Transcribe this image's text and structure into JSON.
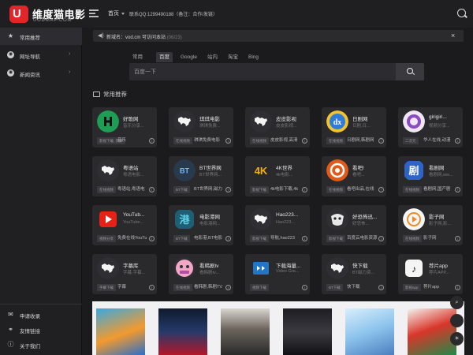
{
  "header": {
    "logo_mark": "U",
    "logo_title": "维度猫电影",
    "logo_sub": "UODMAP.COM",
    "nav_home": "首页",
    "contact": "联系QQ:1299490188（备注：合作/发链）"
  },
  "sidebar": {
    "items": [
      {
        "label": "常用推荐"
      },
      {
        "label": "网址导航",
        "arrow": "›"
      },
      {
        "label": "新闻资讯",
        "arrow": "›"
      }
    ],
    "bottom": [
      {
        "label": "申请收录"
      },
      {
        "label": "友情链接"
      },
      {
        "label": "关于我们"
      }
    ]
  },
  "notice": {
    "text": "新域名：vod.cm 可访问本站",
    "date": "(06/23)",
    "close": "×"
  },
  "search": {
    "tabs": [
      "常用",
      "百度",
      "Google",
      "站内",
      "淘宝",
      "Bing"
    ],
    "active_tab": 1,
    "placeholder": "百度一下"
  },
  "section": {
    "title": "常用推荐"
  },
  "cards": [
    {
      "name": "好歌网",
      "desc": "音乐分享...",
      "tag": "影视下载, 资源",
      "sub": "音乐",
      "icon": "h",
      "color": "#1f9d55"
    },
    {
      "name": "琪琪电影",
      "desc": "琪琪免费...",
      "tag": "在线视频",
      "sub": "琪琪免费电影",
      "icon": "map",
      "color": "#2f2f33"
    },
    {
      "name": "皮皮影视",
      "desc": "皮皮影视...",
      "tag": "在线视频",
      "sub": "皮皮影视,高清",
      "icon": "map",
      "color": "#2f2f33"
    },
    {
      "name": "日剧网",
      "desc": "日剧,日...",
      "tag": "在线视频",
      "sub": "日剧网,韩剧网",
      "icon": "dx",
      "color": "#2f7bd8"
    },
    {
      "name": "girigiri...",
      "desc": "视频分享...",
      "tag": "二次元",
      "sub": "华人在线,动漫",
      "icon": "g",
      "color": "#8a4ac0"
    },
    {
      "name": "粤语站",
      "desc": "粤语电影...",
      "tag": "在线视频",
      "sub": "粤语站,粤语电",
      "icon": "map",
      "color": "#2f2f33"
    },
    {
      "name": "BT世界网",
      "desc": "BT世界网...",
      "tag": "BT下载",
      "sub": "BT世界网,磁力",
      "icon": "BT",
      "color": "#2a3a4e"
    },
    {
      "name": "4K世界",
      "desc": "4k电影...",
      "tag": "影视下载",
      "sub": "4k电影下载,4k",
      "icon": "4K",
      "color": "#2f2f33"
    },
    {
      "name": "看吧!",
      "desc": "看吧...",
      "tag": "在线视频",
      "sub": "看吧出品,在线",
      "icon": "k",
      "color": "#e05a1a"
    },
    {
      "name": "看剧网",
      "desc": "看剧网,ww...",
      "tag": "在线视频",
      "sub": "看剧网,国产剧",
      "icon": "剧",
      "color": "#2e64c8"
    },
    {
      "name": "YouTub...",
      "desc": "YouTube...",
      "tag": "视频分享",
      "sub": "免费在线YouTu",
      "icon": "yt",
      "color": "#2f2f33"
    },
    {
      "name": "电影港网",
      "desc": "电影港网...",
      "tag": "BT下载",
      "sub": "电影港,BT电影",
      "icon": "港",
      "color": "#1e5f73"
    },
    {
      "name": "Hao223...",
      "desc": "Hao223...",
      "tag": "影视下载",
      "sub": "导航,hao223",
      "icon": "map",
      "color": "#2f2f33"
    },
    {
      "name": "好恐怖迅...",
      "desc": "好恐怖...",
      "tag": "影视下载",
      "sub": "百度云电影资源",
      "icon": "hk",
      "color": "#2f2f33"
    },
    {
      "name": "影子网",
      "desc": "影子网,影...",
      "tag": "在线视频",
      "sub": "影子网",
      "icon": "yz",
      "color": "#f6f6f6"
    },
    {
      "name": "字幕库",
      "desc": "字幕,字幕...",
      "tag": "字幕下载",
      "sub": "字幕",
      "icon": "map",
      "color": "#2f2f33"
    },
    {
      "name": "看韩剧tv",
      "desc": "看韩剧tv...",
      "tag": "在线视频",
      "sub": "看韩剧,韩剧TV",
      "icon": "tv",
      "color": "#2f2f33"
    },
    {
      "name": "下载海量...",
      "desc": "Video Gra...",
      "tag": "视频下载",
      "sub": "",
      "icon": "dl",
      "color": "#2f2f33"
    },
    {
      "name": "快下载",
      "desc": "BT磁力资...",
      "tag": "BT下载",
      "sub": "快下载",
      "icon": "map",
      "color": "#2f2f33"
    },
    {
      "name": "荐片app",
      "desc": "荐片APP...",
      "tag": "影视app",
      "sub": "荐片app",
      "icon": "jp",
      "color": "#2f2f33"
    }
  ],
  "float": {
    "search": "⌕",
    "theme": "☀"
  }
}
